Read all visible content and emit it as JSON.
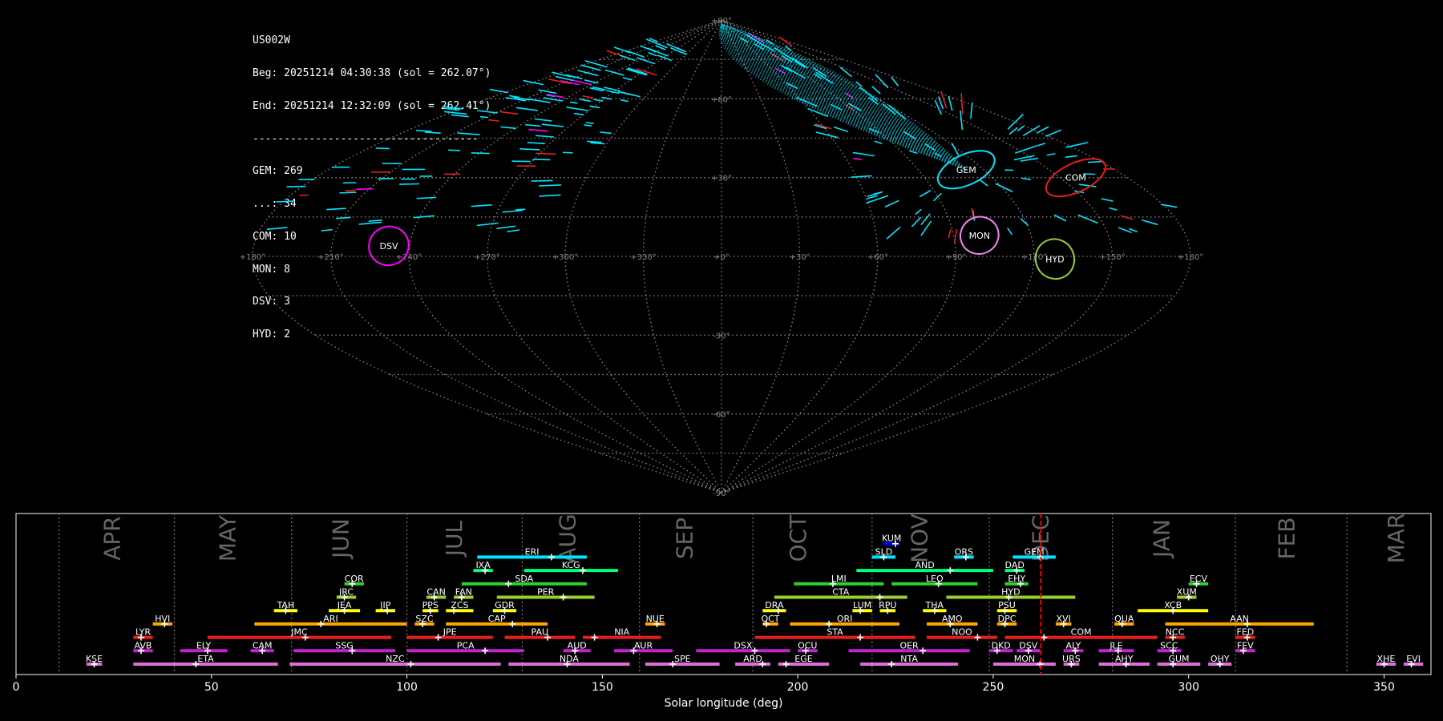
{
  "info": {
    "station": "US002W",
    "begin": "Beg: 20251214 04:30:38 (sol = 262.07°)",
    "end": "End: 20251214 12:32:09 (sol = 262.41°)",
    "separator": "------------------------------------",
    "counts": [
      "GEM: 269",
      "...: 34",
      "COM: 10",
      "MON: 8",
      "DSV: 3",
      "HYD: 2"
    ]
  },
  "sky_map": {
    "projection": "sinusoidal",
    "lon_labels": [
      "+180°",
      "+150°",
      "+120°",
      "+90°",
      "+60°",
      "+30°",
      "+0°",
      "+330°",
      "+300°",
      "+270°",
      "+240°",
      "+210°",
      "+180°"
    ],
    "lat_labels": [
      {
        "lat": 90,
        "text": "+90°"
      },
      {
        "lat": 60,
        "text": "+60°"
      },
      {
        "lat": 30,
        "text": "+30°"
      },
      {
        "lat": -30,
        "text": "-30°"
      },
      {
        "lat": -60,
        "text": "-60°"
      },
      {
        "lat": -90,
        "text": "-90°"
      }
    ],
    "radiants": [
      {
        "name": "GEM",
        "lon": 112,
        "lat": 33,
        "color": "#00e5ff"
      },
      {
        "name": "COM",
        "lon": 157,
        "lat": 30,
        "color": "#e61e1e"
      },
      {
        "name": "MON",
        "lon": 100,
        "lat": 8,
        "color": "#ee82ee"
      },
      {
        "name": "HYD",
        "lon": 128,
        "lat": -1,
        "color": "#9acd32"
      },
      {
        "name": "DSV",
        "lon": 232,
        "lat": 4,
        "color": "#ff00ff"
      }
    ]
  },
  "chart_data": {
    "type": "gantt",
    "xlabel": "Solar longitude (deg)",
    "xlim": [
      0,
      362
    ],
    "xticks": [
      0,
      50,
      100,
      150,
      200,
      250,
      300,
      350
    ],
    "current_sol": 262.2,
    "months": [
      {
        "label": "APR",
        "x": 24.5
      },
      {
        "label": "MAY",
        "x": 54
      },
      {
        "label": "JUN",
        "x": 83
      },
      {
        "label": "JUL",
        "x": 112
      },
      {
        "label": "AUG",
        "x": 141
      },
      {
        "label": "SEP",
        "x": 171
      },
      {
        "label": "OCT",
        "x": 200
      },
      {
        "label": "NOV",
        "x": 231
      },
      {
        "label": "DEC",
        "x": 262
      },
      {
        "label": "JAN",
        "x": 293
      },
      {
        "label": "FEB",
        "x": 325
      },
      {
        "label": "MAR",
        "x": 353
      }
    ],
    "month_boundaries": [
      11,
      40.5,
      70.5,
      100,
      129.5,
      159.5,
      188.5,
      219,
      249,
      280.5,
      312,
      340.5
    ],
    "showers": [
      {
        "code": "KUM",
        "row": 9,
        "start": 222,
        "end": 226,
        "peak": 225,
        "color": "#0000ff"
      },
      {
        "code": "ERI",
        "row": 8,
        "start": 118,
        "end": 146,
        "peak": 137,
        "color": "#00e5ff"
      },
      {
        "code": "SLD",
        "row": 8,
        "start": 219,
        "end": 225,
        "peak": 222,
        "color": "#00e5ff"
      },
      {
        "code": "ORS",
        "row": 8,
        "start": 240,
        "end": 245,
        "peak": 243,
        "color": "#00e5ff"
      },
      {
        "code": "GEM",
        "row": 8,
        "start": 255,
        "end": 266,
        "peak": 262,
        "color": "#00e5ff"
      },
      {
        "code": "IXA",
        "row": 7,
        "start": 117,
        "end": 122,
        "peak": 120,
        "color": "#00ff7f"
      },
      {
        "code": "KCG",
        "row": 7,
        "start": 130,
        "end": 154,
        "peak": 145,
        "color": "#00ff7f"
      },
      {
        "code": "AND",
        "row": 7,
        "start": 215,
        "end": 250,
        "peak": 239,
        "color": "#00ff7f"
      },
      {
        "code": "DAD",
        "row": 7,
        "start": 253,
        "end": 258,
        "peak": 256,
        "color": "#00ff7f"
      },
      {
        "code": "COR",
        "row": 6,
        "start": 84,
        "end": 89,
        "peak": 86,
        "color": "#32cd32"
      },
      {
        "code": "SDA",
        "row": 6,
        "start": 114,
        "end": 146,
        "peak": 126,
        "color": "#32cd32"
      },
      {
        "code": "LMI",
        "row": 6,
        "start": 199,
        "end": 222,
        "peak": 209,
        "color": "#32cd32"
      },
      {
        "code": "LEO",
        "row": 6,
        "start": 224,
        "end": 246,
        "peak": 236,
        "color": "#32cd32"
      },
      {
        "code": "EHY",
        "row": 6,
        "start": 253,
        "end": 259,
        "peak": 257,
        "color": "#32cd32"
      },
      {
        "code": "ECV",
        "row": 6,
        "start": 300,
        "end": 305,
        "peak": 302,
        "color": "#32cd32"
      },
      {
        "code": "JRC",
        "row": 5,
        "start": 82,
        "end": 87,
        "peak": 84,
        "color": "#9acd32"
      },
      {
        "code": "CAN",
        "row": 5,
        "start": 105,
        "end": 110,
        "peak": 107,
        "color": "#9acd32"
      },
      {
        "code": "FAN",
        "row": 5,
        "start": 112,
        "end": 117,
        "peak": 114,
        "color": "#9acd32"
      },
      {
        "code": "PER",
        "row": 5,
        "start": 123,
        "end": 148,
        "peak": 140,
        "color": "#9acd32"
      },
      {
        "code": "CTA",
        "row": 5,
        "start": 194,
        "end": 228,
        "peak": 221,
        "color": "#9acd32"
      },
      {
        "code": "HYD",
        "row": 5,
        "start": 238,
        "end": 271,
        "peak": 254,
        "color": "#9acd32"
      },
      {
        "code": "XUM",
        "row": 5,
        "start": 297,
        "end": 302,
        "peak": 300,
        "color": "#9acd32"
      },
      {
        "code": "TAH",
        "row": 4,
        "start": 66,
        "end": 72,
        "peak": 69,
        "color": "#ffff00"
      },
      {
        "code": "JEA",
        "row": 4,
        "start": 80,
        "end": 88,
        "peak": 84,
        "color": "#ffff00"
      },
      {
        "code": "JIP",
        "row": 4,
        "start": 92,
        "end": 97,
        "peak": 95,
        "color": "#ffff00"
      },
      {
        "code": "PPS",
        "row": 4,
        "start": 104,
        "end": 108,
        "peak": 106,
        "color": "#ffff00"
      },
      {
        "code": "ZCS",
        "row": 4,
        "start": 110,
        "end": 117,
        "peak": 112,
        "color": "#ffff00"
      },
      {
        "code": "GDR",
        "row": 4,
        "start": 122,
        "end": 128,
        "peak": 125,
        "color": "#ffff00"
      },
      {
        "code": "DRA",
        "row": 4,
        "start": 191,
        "end": 197,
        "peak": 195,
        "color": "#ffff00"
      },
      {
        "code": "LUM",
        "row": 4,
        "start": 214,
        "end": 219,
        "peak": 216,
        "color": "#ffff00"
      },
      {
        "code": "RPU",
        "row": 4,
        "start": 221,
        "end": 225,
        "peak": 223,
        "color": "#ffff00"
      },
      {
        "code": "THA",
        "row": 4,
        "start": 232,
        "end": 238,
        "peak": 235,
        "color": "#ffff00"
      },
      {
        "code": "PSU",
        "row": 4,
        "start": 251,
        "end": 256,
        "peak": 253,
        "color": "#ffff00"
      },
      {
        "code": "XCB",
        "row": 4,
        "start": 287,
        "end": 305,
        "peak": 296,
        "color": "#ffff00"
      },
      {
        "code": "HVI",
        "row": 3,
        "start": 35,
        "end": 40,
        "peak": 38,
        "color": "#ffa500"
      },
      {
        "code": "ARI",
        "row": 3,
        "start": 61,
        "end": 100,
        "peak": 78,
        "color": "#ffa500"
      },
      {
        "code": "SZC",
        "row": 3,
        "start": 102,
        "end": 107,
        "peak": 104,
        "color": "#ffa500"
      },
      {
        "code": "CAP",
        "row": 3,
        "start": 110,
        "end": 136,
        "peak": 127,
        "color": "#ffa500"
      },
      {
        "code": "NUE",
        "row": 3,
        "start": 161,
        "end": 166,
        "peak": 164,
        "color": "#ffa500"
      },
      {
        "code": "OCT",
        "row": 3,
        "start": 191,
        "end": 195,
        "peak": 192,
        "color": "#ffa500"
      },
      {
        "code": "ORI",
        "row": 3,
        "start": 198,
        "end": 226,
        "peak": 208,
        "color": "#ffa500"
      },
      {
        "code": "AMO",
        "row": 3,
        "start": 233,
        "end": 246,
        "peak": 239,
        "color": "#ffa500"
      },
      {
        "code": "DPC",
        "row": 3,
        "start": 251,
        "end": 256,
        "peak": 253,
        "color": "#ffa500"
      },
      {
        "code": "XVI",
        "row": 3,
        "start": 266,
        "end": 270,
        "peak": 268,
        "color": "#ffa500"
      },
      {
        "code": "QUA",
        "row": 3,
        "start": 281,
        "end": 286,
        "peak": 283,
        "color": "#ffa500"
      },
      {
        "code": "AAN",
        "row": 3,
        "start": 294,
        "end": 332,
        "peak": 315,
        "color": "#ffa500"
      },
      {
        "code": "LYR",
        "row": 2,
        "start": 30,
        "end": 35,
        "peak": 32,
        "color": "#e61e1e"
      },
      {
        "code": "JMC",
        "row": 2,
        "start": 49,
        "end": 96,
        "peak": 74,
        "color": "#e61e1e"
      },
      {
        "code": "JPE",
        "row": 2,
        "start": 100,
        "end": 122,
        "peak": 108,
        "color": "#e61e1e"
      },
      {
        "code": "PAU",
        "row": 2,
        "start": 125,
        "end": 143,
        "peak": 136,
        "color": "#e61e1e"
      },
      {
        "code": "NIA",
        "row": 2,
        "start": 145,
        "end": 165,
        "peak": 148,
        "color": "#e61e1e"
      },
      {
        "code": "STA",
        "row": 2,
        "start": 189,
        "end": 230,
        "peak": 216,
        "color": "#e61e1e"
      },
      {
        "code": "NOO",
        "row": 2,
        "start": 233,
        "end": 251,
        "peak": 246,
        "color": "#e61e1e"
      },
      {
        "code": "COM",
        "row": 2,
        "start": 253,
        "end": 292,
        "peak": 263,
        "color": "#e61e1e"
      },
      {
        "code": "NCC",
        "row": 2,
        "start": 294,
        "end": 299,
        "peak": 296,
        "color": "#e61e1e"
      },
      {
        "code": "FED",
        "row": 2,
        "start": 312,
        "end": 317,
        "peak": 315,
        "color": "#e61e1e"
      },
      {
        "code": "AVB",
        "row": 1,
        "start": 30,
        "end": 35,
        "peak": 32,
        "color": "#c71fd6"
      },
      {
        "code": "ELY",
        "row": 1,
        "start": 42,
        "end": 54,
        "peak": 49,
        "color": "#c71fd6"
      },
      {
        "code": "CAM",
        "row": 1,
        "start": 60,
        "end": 66,
        "peak": 63,
        "color": "#c71fd6"
      },
      {
        "code": "SSG",
        "row": 1,
        "start": 71,
        "end": 97,
        "peak": 86,
        "color": "#c71fd6"
      },
      {
        "code": "PCA",
        "row": 1,
        "start": 100,
        "end": 130,
        "peak": 120,
        "color": "#c71fd6"
      },
      {
        "code": "AUD",
        "row": 1,
        "start": 140,
        "end": 147,
        "peak": 143,
        "color": "#c71fd6"
      },
      {
        "code": "AUR",
        "row": 1,
        "start": 153,
        "end": 168,
        "peak": 158,
        "color": "#c71fd6"
      },
      {
        "code": "DSX",
        "row": 1,
        "start": 174,
        "end": 198,
        "peak": 189,
        "color": "#c71fd6"
      },
      {
        "code": "OCU",
        "row": 1,
        "start": 200,
        "end": 205,
        "peak": 202,
        "color": "#c71fd6"
      },
      {
        "code": "OER",
        "row": 1,
        "start": 213,
        "end": 244,
        "peak": 232,
        "color": "#c71fd6"
      },
      {
        "code": "DKD",
        "row": 1,
        "start": 249,
        "end": 255,
        "peak": 251,
        "color": "#c71fd6"
      },
      {
        "code": "DSV",
        "row": 1,
        "start": 256,
        "end": 262,
        "peak": 259,
        "color": "#c71fd6"
      },
      {
        "code": "ALY",
        "row": 1,
        "start": 268,
        "end": 273,
        "peak": 271,
        "color": "#c71fd6"
      },
      {
        "code": "JLE",
        "row": 1,
        "start": 277,
        "end": 286,
        "peak": 282,
        "color": "#c71fd6"
      },
      {
        "code": "SCC",
        "row": 1,
        "start": 292,
        "end": 298,
        "peak": 296,
        "color": "#c71fd6"
      },
      {
        "code": "FEV",
        "row": 1,
        "start": 312,
        "end": 317,
        "peak": 314,
        "color": "#c71fd6"
      },
      {
        "code": "KSE",
        "row": 0,
        "start": 18,
        "end": 22,
        "peak": 20,
        "color": "#da70d6"
      },
      {
        "code": "ETA",
        "row": 0,
        "start": 30,
        "end": 67,
        "peak": 46,
        "color": "#da70d6"
      },
      {
        "code": "NZC",
        "row": 0,
        "start": 70,
        "end": 124,
        "peak": 101,
        "color": "#da70d6"
      },
      {
        "code": "NDA",
        "row": 0,
        "start": 126,
        "end": 157,
        "peak": 141,
        "color": "#da70d6"
      },
      {
        "code": "SPE",
        "row": 0,
        "start": 161,
        "end": 180,
        "peak": 168,
        "color": "#da70d6"
      },
      {
        "code": "ARD",
        "row": 0,
        "start": 184,
        "end": 193,
        "peak": 191,
        "color": "#da70d6"
      },
      {
        "code": "EGE",
        "row": 0,
        "start": 195,
        "end": 208,
        "peak": 197,
        "color": "#da70d6"
      },
      {
        "code": "NTA",
        "row": 0,
        "start": 216,
        "end": 241,
        "peak": 224,
        "color": "#da70d6"
      },
      {
        "code": "MON",
        "row": 0,
        "start": 250,
        "end": 266,
        "peak": 262,
        "color": "#da70d6"
      },
      {
        "code": "URS",
        "row": 0,
        "start": 268,
        "end": 272,
        "peak": 270,
        "color": "#da70d6"
      },
      {
        "code": "AHY",
        "row": 0,
        "start": 277,
        "end": 290,
        "peak": 284,
        "color": "#da70d6"
      },
      {
        "code": "GUM",
        "row": 0,
        "start": 292,
        "end": 303,
        "peak": 296,
        "color": "#da70d6"
      },
      {
        "code": "OHY",
        "row": 0,
        "start": 305,
        "end": 311,
        "peak": 308,
        "color": "#da70d6"
      },
      {
        "code": "XHE",
        "row": 0,
        "start": 348,
        "end": 353,
        "peak": 350,
        "color": "#da70d6"
      },
      {
        "code": "EVI",
        "row": 0,
        "start": 355,
        "end": 360,
        "peak": 357,
        "color": "#da70d6"
      }
    ]
  }
}
